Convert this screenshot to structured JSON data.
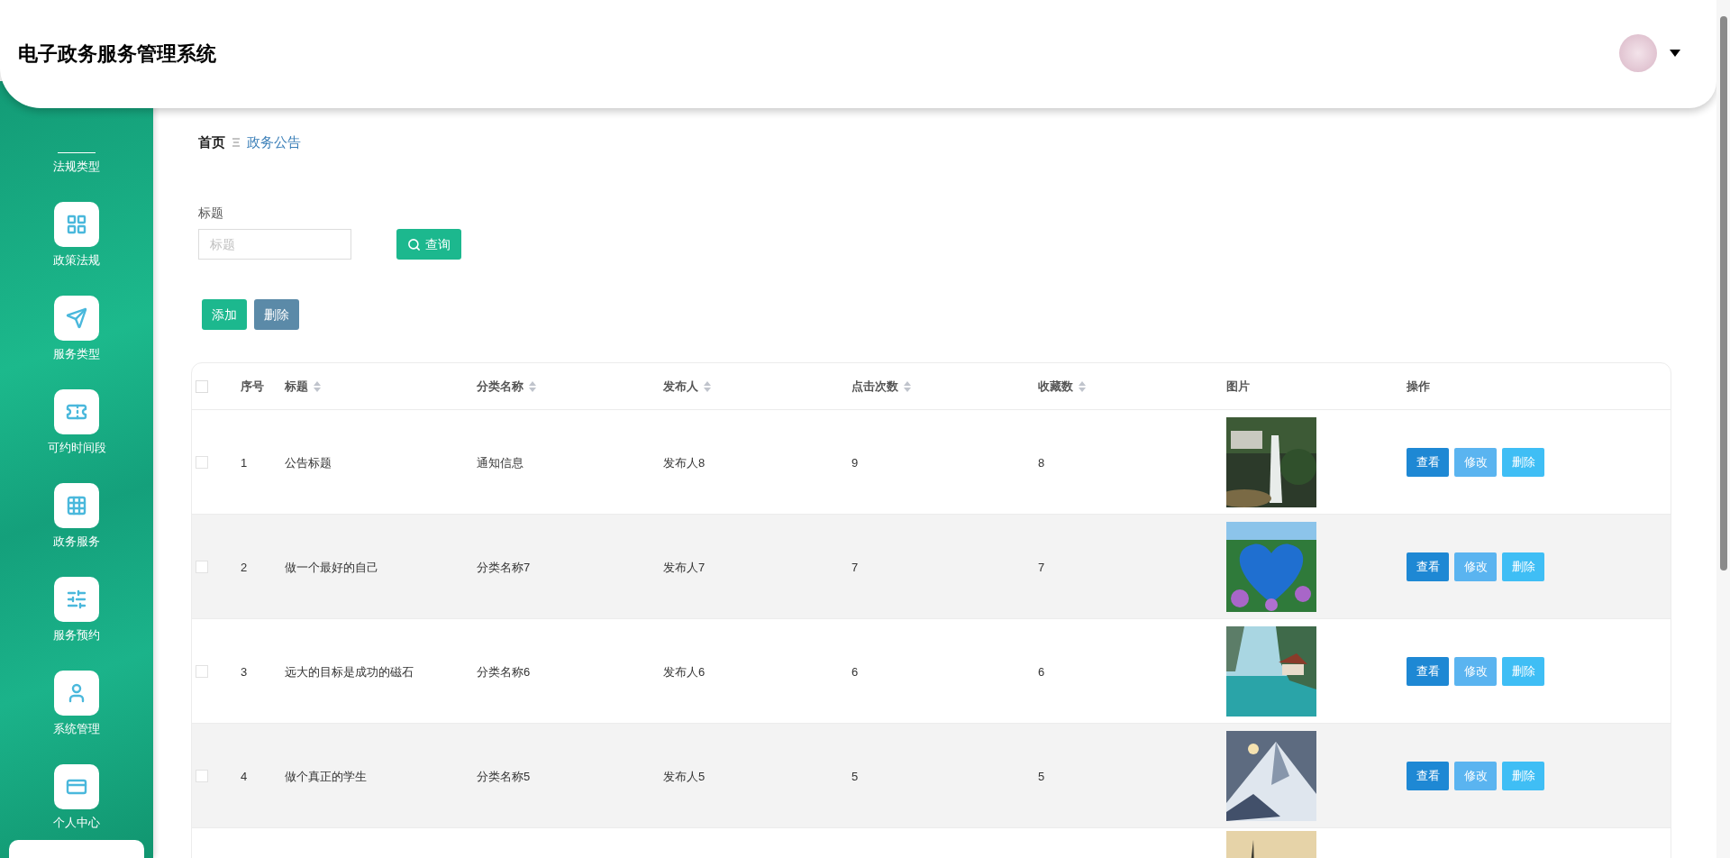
{
  "header": {
    "title": "电子政务服务管理系统"
  },
  "sidebar": {
    "items": [
      {
        "label": "法规类型"
      },
      {
        "label": "政策法规"
      },
      {
        "label": "服务类型"
      },
      {
        "label": "可约时间段"
      },
      {
        "label": "政务服务"
      },
      {
        "label": "服务预约"
      },
      {
        "label": "系统管理"
      },
      {
        "label": "个人中心"
      }
    ]
  },
  "breadcrumb": [
    {
      "label": "首页",
      "selected": false
    },
    {
      "label": "政务公告",
      "selected": true
    }
  ],
  "search": {
    "label": "标题",
    "placeholder": "标题",
    "button": "查询"
  },
  "actions": [
    {
      "label": "添加",
      "kind": "add"
    },
    {
      "label": "删除",
      "kind": "delete"
    }
  ],
  "table": {
    "select_all_checked": false,
    "columns": [
      {
        "label": "序号",
        "sortable": false
      },
      {
        "label": "标题",
        "sortable": true
      },
      {
        "label": "分类名称",
        "sortable": true
      },
      {
        "label": "发布人",
        "sortable": true
      },
      {
        "label": "点击次数",
        "sortable": true
      },
      {
        "label": "收藏数",
        "sortable": true
      },
      {
        "label": "图片",
        "sortable": false
      },
      {
        "label": "操作",
        "sortable": false
      }
    ],
    "rows": [
      {
        "checked": false,
        "cells": [
          "1",
          "公告标题",
          "通知信息",
          "发布人8",
          "9",
          "8"
        ],
        "image": {
          "kind": "picture"
        },
        "buttons": [
          {
            "label": "查看",
            "kind": "view"
          },
          {
            "label": "修改",
            "kind": "edit"
          },
          {
            "label": "删除",
            "kind": "delete"
          }
        ]
      },
      {
        "checked": false,
        "cells": [
          "2",
          "做一个最好的自己",
          "分类名称7",
          "发布人7",
          "7",
          "7"
        ],
        "image": {
          "kind": "picture"
        },
        "buttons": [
          {
            "label": "查看",
            "kind": "view"
          },
          {
            "label": "修改",
            "kind": "edit"
          },
          {
            "label": "删除",
            "kind": "delete"
          }
        ]
      },
      {
        "checked": false,
        "cells": [
          "3",
          "远大的目标是成功的磁石",
          "分类名称6",
          "发布人6",
          "6",
          "6"
        ],
        "image": {
          "kind": "picture"
        },
        "buttons": [
          {
            "label": "查看",
            "kind": "view"
          },
          {
            "label": "修改",
            "kind": "edit"
          },
          {
            "label": "删除",
            "kind": "delete"
          }
        ]
      },
      {
        "checked": false,
        "cells": [
          "4",
          "做个真正的学生",
          "分类名称5",
          "发布人5",
          "5",
          "5"
        ],
        "image": {
          "kind": "picture"
        },
        "buttons": [
          {
            "label": "查看",
            "kind": "view"
          },
          {
            "label": "修改",
            "kind": "edit"
          },
          {
            "label": "删除",
            "kind": "delete"
          }
        ]
      },
      {
        "image": {
          "kind": "picture"
        }
      }
    ]
  }
}
